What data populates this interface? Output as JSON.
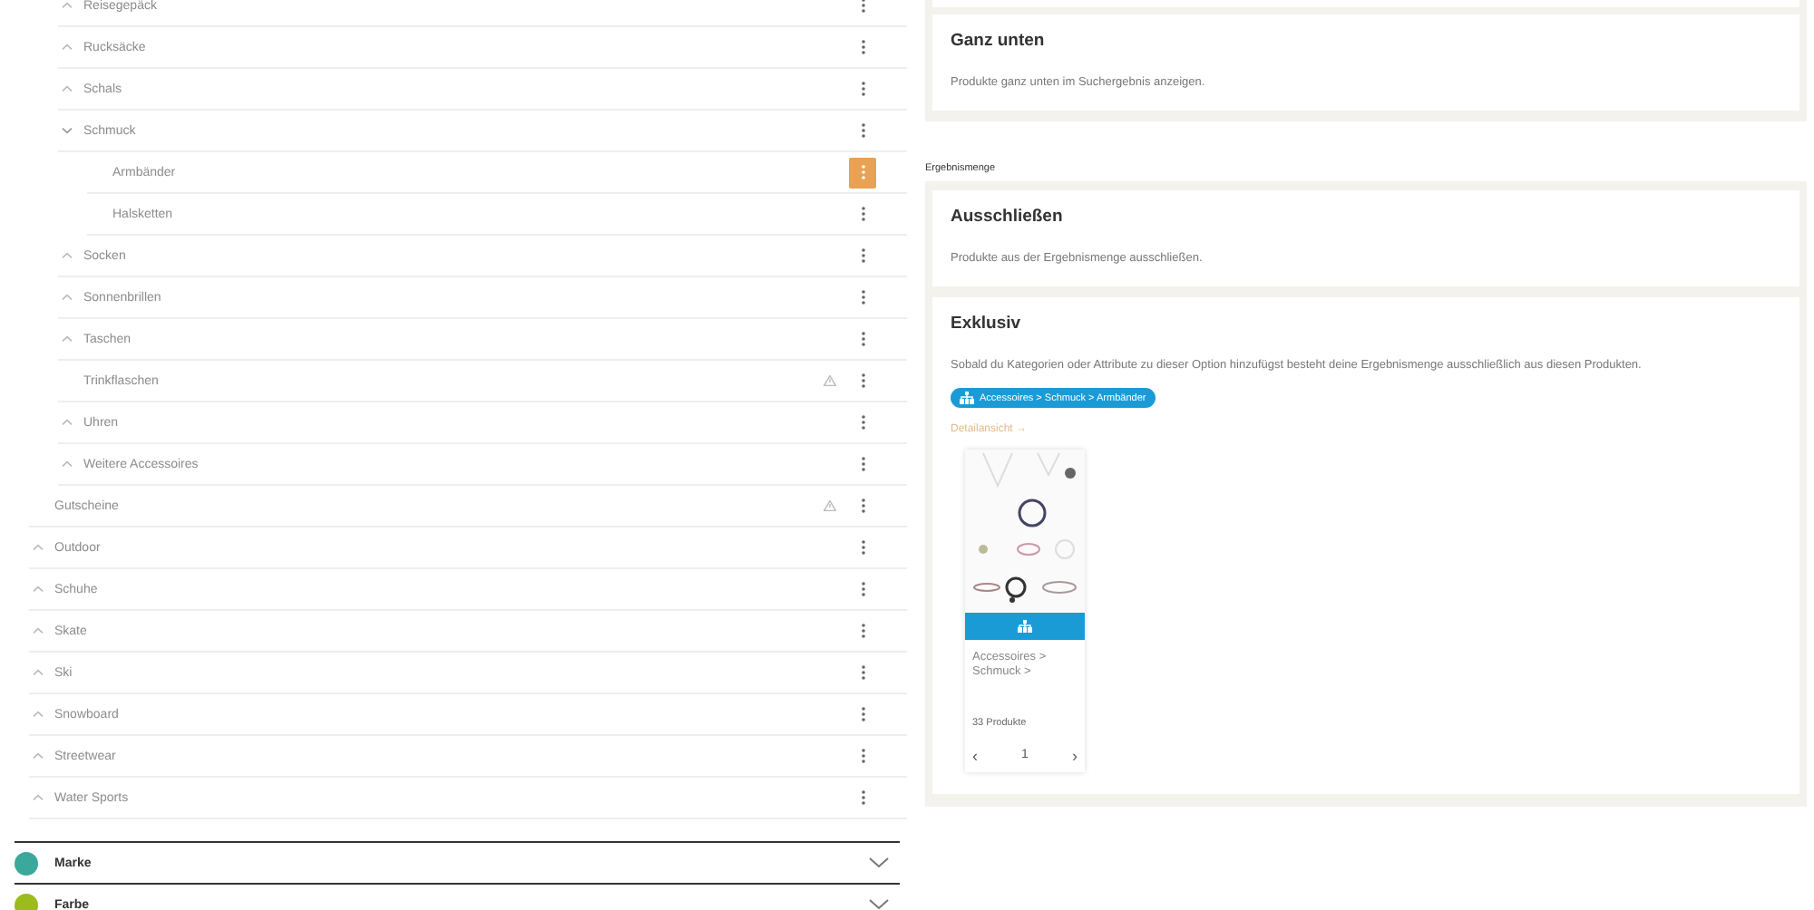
{
  "category_tree": [
    {
      "children": [
        {
          "label": "Reisegepäck",
          "expanded": false,
          "selected": false
        },
        {
          "label": "Rucksäcke",
          "expanded": false,
          "selected": false
        },
        {
          "label": "Schals",
          "expanded": false,
          "selected": false
        },
        {
          "label": "Schmuck",
          "expanded": true,
          "selected": false,
          "children": [
            {
              "label": "Armbänder",
              "selected": true
            },
            {
              "label": "Halsketten",
              "selected": false
            }
          ]
        },
        {
          "label": "Socken",
          "expanded": false,
          "selected": false
        },
        {
          "label": "Sonnenbrillen",
          "expanded": false,
          "selected": false
        },
        {
          "label": "Taschen",
          "expanded": false,
          "selected": false
        },
        {
          "label": "Trinkflaschen",
          "warning": true,
          "selected": false
        },
        {
          "label": "Uhren",
          "expanded": false,
          "selected": false
        },
        {
          "label": "Weitere Accessoires",
          "expanded": false,
          "selected": false
        }
      ]
    },
    {
      "label": "Gutscheine",
      "warning": true,
      "selected": false
    },
    {
      "label": "Outdoor",
      "expanded": false,
      "selected": false
    },
    {
      "label": "Schuhe",
      "expanded": false,
      "selected": false
    },
    {
      "label": "Skate",
      "expanded": false,
      "selected": false
    },
    {
      "label": "Ski",
      "expanded": false,
      "selected": false
    },
    {
      "label": "Snowboard",
      "expanded": false,
      "selected": false
    },
    {
      "label": "Streetwear",
      "expanded": false,
      "selected": false
    },
    {
      "label": "Water Sports",
      "expanded": false,
      "selected": false
    }
  ],
  "filter_sections": [
    {
      "label": "Marke",
      "color": "#3aa89a",
      "expanded": false
    },
    {
      "label": "Farbe",
      "color": "#9cbb1c",
      "expanded": false
    }
  ],
  "options": [
    {
      "title": "Ganz unten",
      "description": "Produkte ganz unten im Suchergebnis anzeigen."
    }
  ],
  "result_set": {
    "label": "Ergebnismenge",
    "options": [
      {
        "kind": "plain",
        "title": "Ausschließen",
        "description": "Produkte aus der Ergebnismenge ausschließen."
      },
      {
        "kind": "rule",
        "title": "Exklusiv",
        "description": "Sobald du Kategorien oder Attribute zu dieser Option hinzufügst besteht deine Ergebnismenge ausschließlich aus diesen Produkten.",
        "tag": "Accessoires > Schmuck > Armbänder",
        "detail_link": "Detailansicht →",
        "product_card": {
          "title": "Accessoires > Schmuck >",
          "count": "33 Produkte",
          "prev": "‹",
          "page": "1",
          "next": "›"
        }
      }
    ]
  }
}
